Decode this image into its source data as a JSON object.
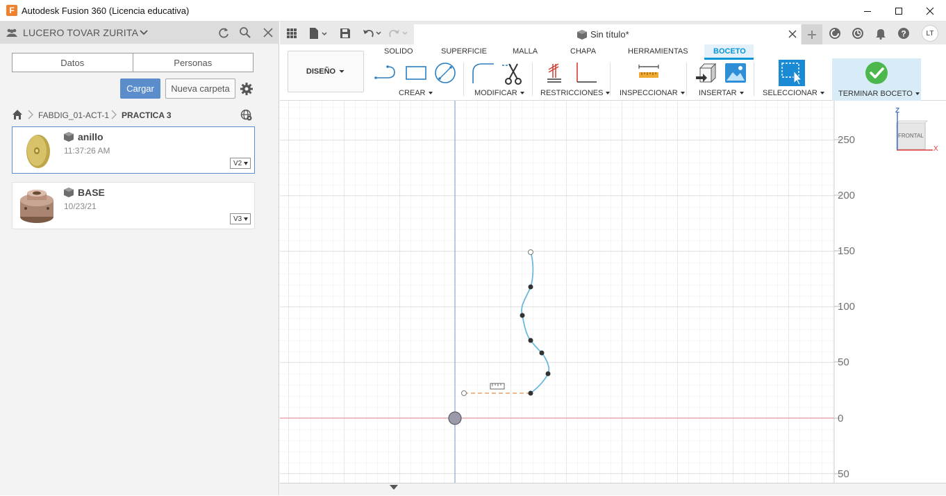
{
  "window": {
    "title": "Autodesk Fusion 360 (Licencia educativa)",
    "logo_letter": "F"
  },
  "data_panel": {
    "user_name": "LUCERO TOVAR ZURITA",
    "tabs": [
      {
        "label": "Datos"
      },
      {
        "label": "Personas"
      }
    ],
    "upload_label": "Cargar",
    "new_folder_label": "Nueva carpeta",
    "breadcrumb": {
      "project": "FABDIG_01-ACT-1",
      "folder": "PRACTICA 3"
    },
    "files": [
      {
        "name": "anillo",
        "date": "11:37:26 AM",
        "version": "V2",
        "selected": true
      },
      {
        "name": "BASE",
        "date": "10/23/21",
        "version": "V3",
        "selected": false
      }
    ]
  },
  "document": {
    "title": "Sin título*"
  },
  "user_initials": "LT",
  "toolbar": {
    "workspace_label": "DISEÑO",
    "tabs": [
      {
        "label": "SOLIDO",
        "active": false
      },
      {
        "label": "SUPERFICIE",
        "active": false
      },
      {
        "label": "MALLA",
        "active": false
      },
      {
        "label": "CHAPA",
        "active": false
      },
      {
        "label": "HERRAMIENTAS",
        "active": false
      },
      {
        "label": "BOCETO",
        "active": true
      }
    ],
    "groups": [
      {
        "label": "CREAR"
      },
      {
        "label": "MODIFICAR"
      },
      {
        "label": "RESTRICCIONES"
      },
      {
        "label": "INSPECCIONAR"
      },
      {
        "label": "INSERTAR"
      },
      {
        "label": "SELECCIONAR"
      },
      {
        "label": "TERMINAR BOCETO"
      }
    ]
  },
  "viewcube": {
    "face_label": "FRONTAL",
    "axis_z": "Z",
    "axis_x": "X"
  },
  "ruler": {
    "labels": [
      "250",
      "200",
      "150",
      "100",
      "50",
      "0",
      "50"
    ]
  },
  "colors": {
    "accent": "#0696d7",
    "upload_button": "#5b8ccc",
    "spline": "#6bb8df",
    "construction_line": "#e6a06a",
    "x_axis": "#f2a2a2",
    "y_axis": "#8fa3c9",
    "finish_check": "#4cb74c"
  }
}
